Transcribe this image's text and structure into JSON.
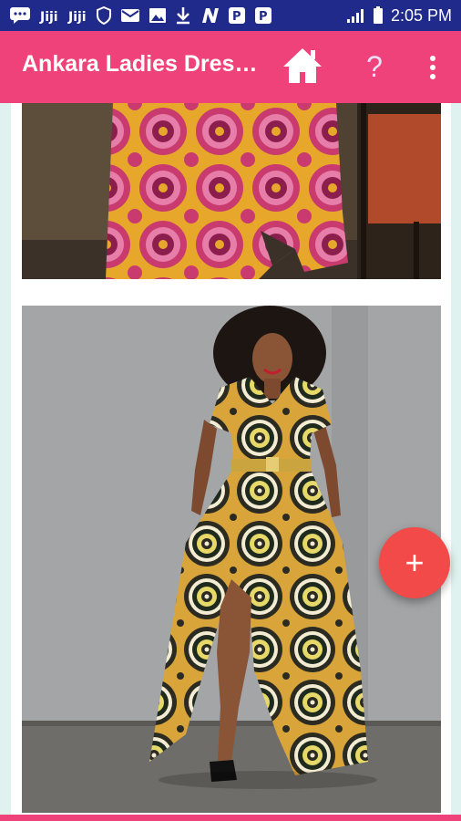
{
  "status_bar": {
    "time": "2:05 PM",
    "icons": [
      "chat-icon",
      "ji-icon",
      "ji-icon",
      "shield-icon",
      "mail-icon",
      "image-icon",
      "download-icon",
      "n-icon",
      "p-icon",
      "p-icon",
      "signal-icon",
      "battery-icon"
    ]
  },
  "app_bar": {
    "title": "Ankara Ladies Dresses",
    "help_label": "?",
    "home_icon": "home-icon",
    "menu_icon": "more-vert-icon"
  },
  "fab": {
    "label": "+",
    "color": "#f24a48"
  },
  "colors": {
    "status_bar": "#1f2a8a",
    "app_bar": "#f0427a",
    "background": "#e0f2ef"
  },
  "images": [
    {
      "name": "ankara-dress-photo-1"
    },
    {
      "name": "ankara-dress-photo-2"
    }
  ]
}
